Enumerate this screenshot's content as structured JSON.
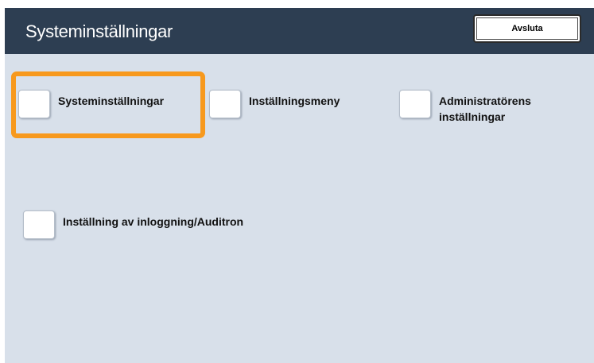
{
  "header": {
    "title": "Systeminställningar",
    "exit_label": "Avsluta"
  },
  "options": {
    "system_settings": {
      "label": "Systeminställningar",
      "selected": true
    },
    "settings_menu": {
      "label": "Inställningsmeny"
    },
    "admin_settings": {
      "label_line1": "Administratörens",
      "label_line2": "inställningar"
    },
    "login_auditron": {
      "label": "Inställning av inloggning/Auditron"
    }
  },
  "colors": {
    "header_bg": "#2d3e52",
    "panel_bg": "#d8e0ea",
    "selection_highlight": "#f7991d"
  }
}
